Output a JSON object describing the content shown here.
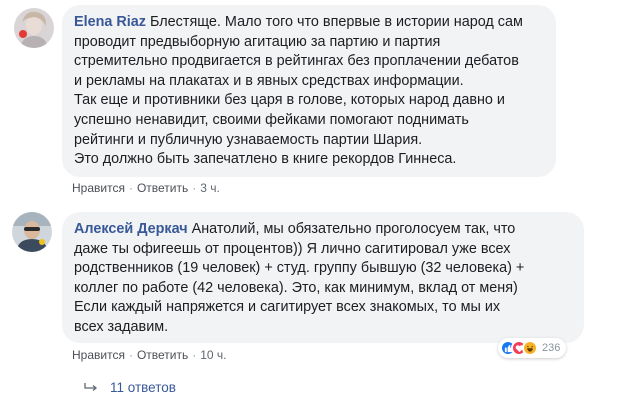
{
  "comments": [
    {
      "author": "Elena Riaz",
      "lines": [
        "Блестяще. Мало того что впервые в истории народ сам",
        "проводит предвыборную агитацию за партию и партия",
        "стремительно продвигается в рейтингах без проплачении дебатов",
        "и рекламы на плакатах и в явных средствах информации.",
        "Так еще и противники без царя в голове, которых народ давно и",
        "успешно ненавидит, своими фейками помогают поднимать",
        "рейтинги и публичную узнаваемость партии Шария.",
        "Это должно быть запечатлено в книге рекордов Гиннеса."
      ],
      "like_label": "Нравится",
      "reply_label": "Ответить",
      "time": "3 ч."
    },
    {
      "author": "Алексей Деркач",
      "lines": [
        "Анатолий, мы обязательно проголосуем так, что",
        "даже ты офигеешь от процентов)) Я лично сагитировал уже всех",
        "родственников (19 человек) + студ. группу бывшую (32 человека) +",
        "коллег по работе (42 человека). Это, как минимум, вклад от меня)",
        "Если каждый напряжется и сагитирует всех знакомых, то мы их",
        "всех задавим."
      ],
      "like_label": "Нравится",
      "reply_label": "Ответить",
      "time": "10 ч.",
      "reactions": {
        "icons": [
          "like-icon",
          "love-icon",
          "haha-icon"
        ],
        "count": "236"
      },
      "replies_label": "11 ответов"
    }
  ],
  "colors": {
    "author": "#385898",
    "bubble": "#f2f3f5",
    "like": "#1877f2",
    "love": "#f33e58",
    "haha": "#f7b125"
  }
}
